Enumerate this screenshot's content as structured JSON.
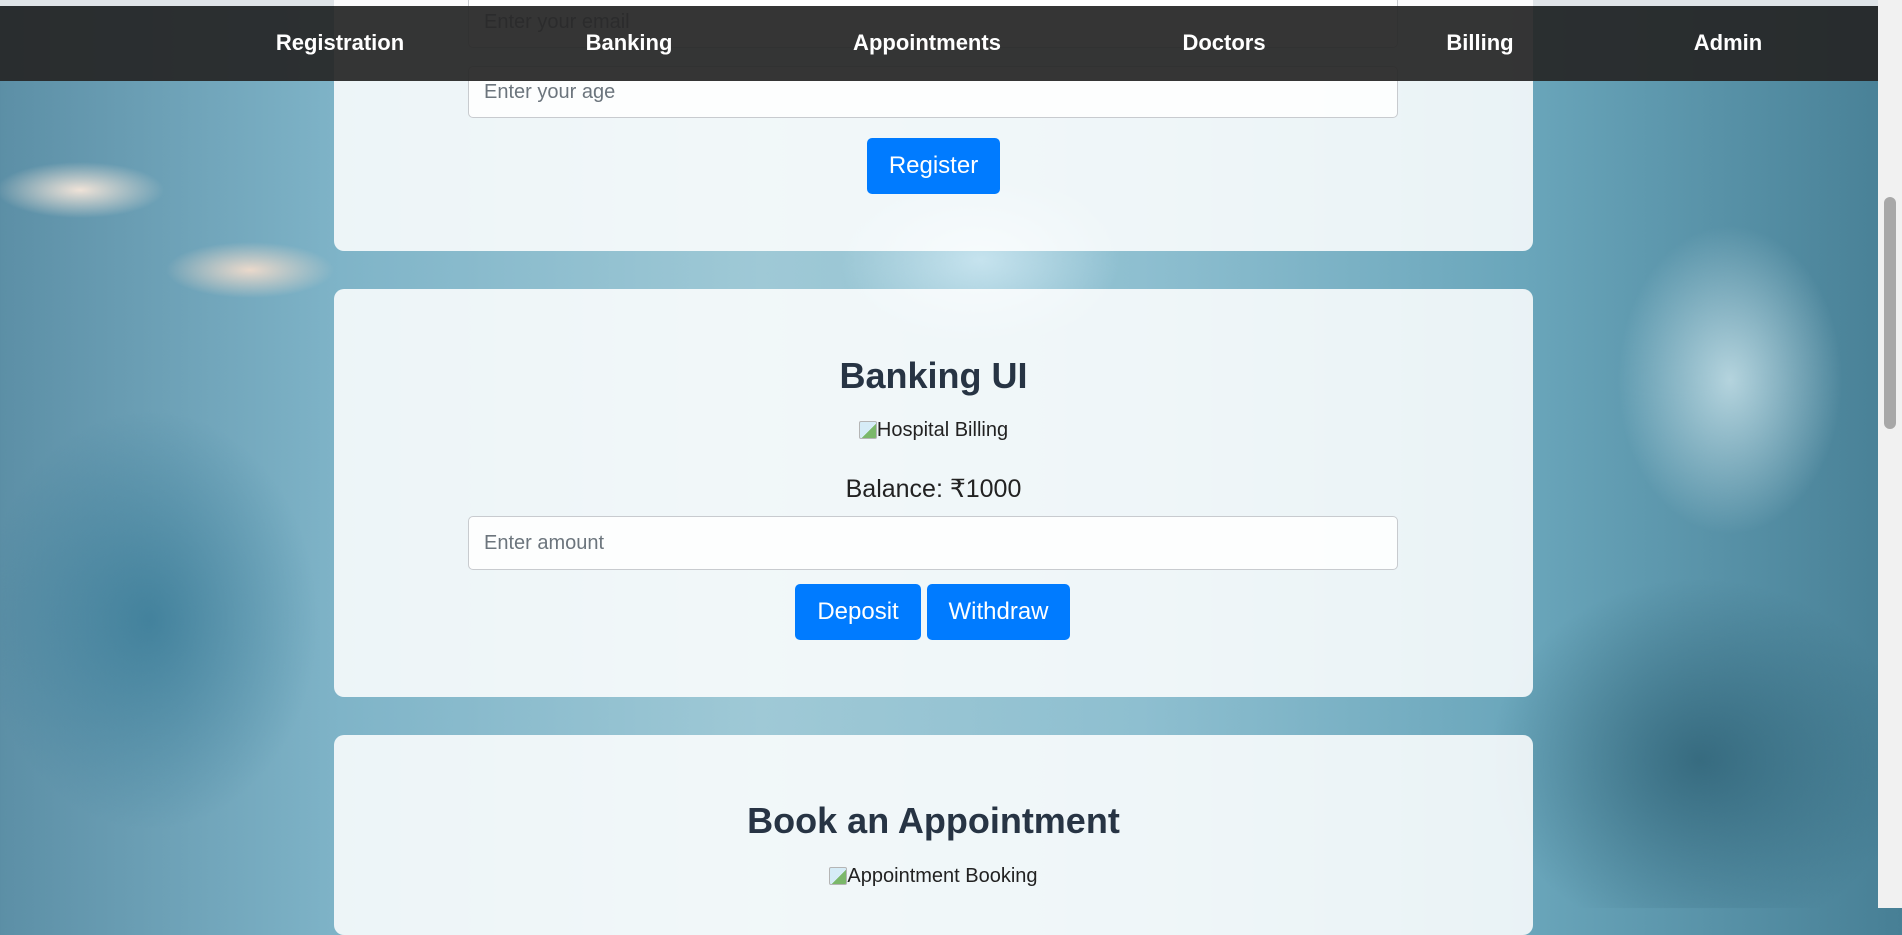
{
  "nav": {
    "items": [
      {
        "label": "Registration"
      },
      {
        "label": "Banking"
      },
      {
        "label": "Appointments"
      },
      {
        "label": "Doctors"
      },
      {
        "label": "Billing"
      },
      {
        "label": "Admin"
      }
    ]
  },
  "registration": {
    "email_placeholder": "Enter your email",
    "age_placeholder": "Enter your age",
    "register_label": "Register"
  },
  "banking": {
    "title": "Banking UI",
    "image_alt": "Hospital Billing",
    "balance_text": "Balance: ₹1000",
    "amount_placeholder": "Enter amount",
    "deposit_label": "Deposit",
    "withdraw_label": "Withdraw"
  },
  "appointment": {
    "title": "Book an Appointment",
    "image_alt": "Appointment Booking"
  },
  "colors": {
    "primary_button": "#007bff",
    "navbar": "#262626",
    "heading": "#273444"
  }
}
